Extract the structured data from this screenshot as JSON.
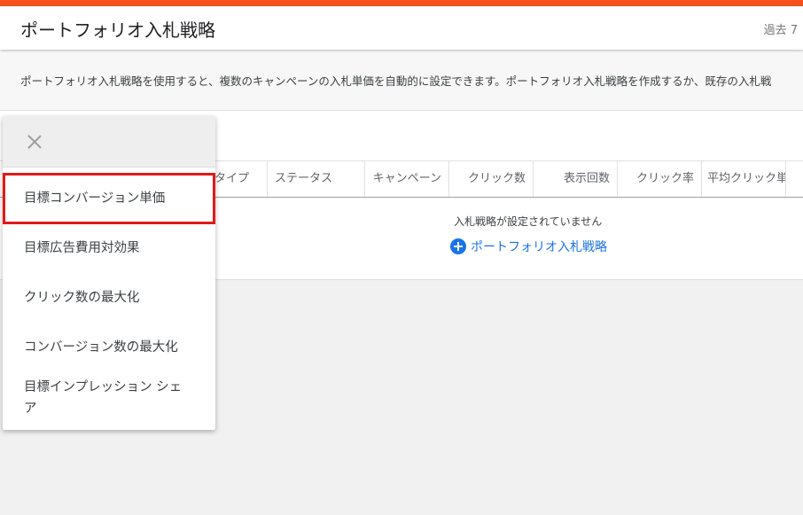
{
  "header": {
    "title": "ポートフォリオ入札戦略",
    "date_range": "過去 7"
  },
  "description": "ポートフォリオ入札戦略を使用すると、複数のキャンペーンの入札単価を自動的に設定できます。ポートフォリオ入札戦略を作成するか、既存の入札戦",
  "table": {
    "columns": [
      "タイプ",
      "ステータス",
      "キャンペーン",
      "クリック数",
      "表示回数",
      "クリック率",
      "平均クリック単"
    ],
    "empty_message": "入札戦略が設定されていません",
    "add_label": "ポートフォリオ入札戦略"
  },
  "dropdown": {
    "items": [
      {
        "label": "目標コンバージョン単価",
        "selected": true
      },
      {
        "label": "目標広告費用対効果",
        "selected": false
      },
      {
        "label": "クリック数の最大化",
        "selected": false
      },
      {
        "label": "コンバージョン数の最大化",
        "selected": false
      },
      {
        "label": "目標インプレッション シェア",
        "selected": false
      }
    ]
  },
  "colors": {
    "accent": "#f4511e",
    "link": "#1a73e8",
    "highlight": "#e01a1a"
  }
}
